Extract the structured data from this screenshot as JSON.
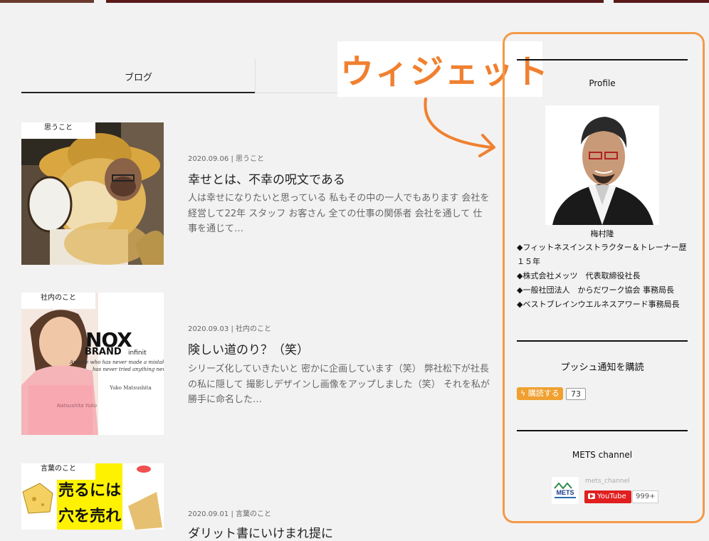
{
  "tabs": {
    "blog_label": "ブログ"
  },
  "posts": [
    {
      "category": "思うこと",
      "date": "2020.09.06",
      "meta_category": "思うこと",
      "title": "幸せとは、不幸の呪文である",
      "excerpt": "人は幸せになりたいと思っている 私もその中の一人でもあります 会社を経営して22年 スタッフ お客さん 全ての仕事の関係者 会社を通して 仕事を通じて…"
    },
    {
      "category": "社内のこと",
      "date": "2020.09.03",
      "meta_category": "社内のこと",
      "title": "険しい道のり？（笑）",
      "excerpt": "シリーズ化していきたいと 密かに企画しています（笑） 弊社松下が社長の私に隠して 撮影しデザインし画像をアップしました（笑） それを私が勝手に命名した…",
      "thumb_text": {
        "brand1": "NOX",
        "brand2": "BRAND",
        "brand_suffix": "infinit",
        "quote1": "Anyone who has never made a mistake",
        "quote2": "has never tried anything new",
        "name": "Yuko Matsushita",
        "signature": "Natsushita Yuko"
      }
    },
    {
      "category": "言葉のこと",
      "date": "2020.09.01",
      "meta_category": "言葉のこと",
      "title": "ダリット書にいけまれ提に",
      "thumb_text": {
        "line1": "売るには",
        "line2": "穴を売れ"
      }
    }
  ],
  "annotation": {
    "label": "ウィジェット"
  },
  "sidebar": {
    "profile": {
      "title": "Profile",
      "name": "梅村隆",
      "lines": [
        "◆フィットネスインストラクター＆トレーナー歴１５年",
        "◆株式会社メッツ　代表取締役社長",
        "◆一般社団法人　からだワーク協会 事務局長",
        "◆ベストブレインウエルネスアワード事務局長"
      ]
    },
    "push": {
      "title": "プッシュ通知を購読",
      "button_label": "購読する",
      "count": "73"
    },
    "youtube": {
      "title": "METS channel",
      "logo_text": "METS",
      "channel_name": "mets_channel",
      "button_label": "YouTube",
      "count": "999+"
    }
  },
  "colors": {
    "accent_orange": "#f08030",
    "frame_orange": "#f39a48",
    "push_orange": "#f0a030",
    "youtube_red": "#e02020"
  }
}
